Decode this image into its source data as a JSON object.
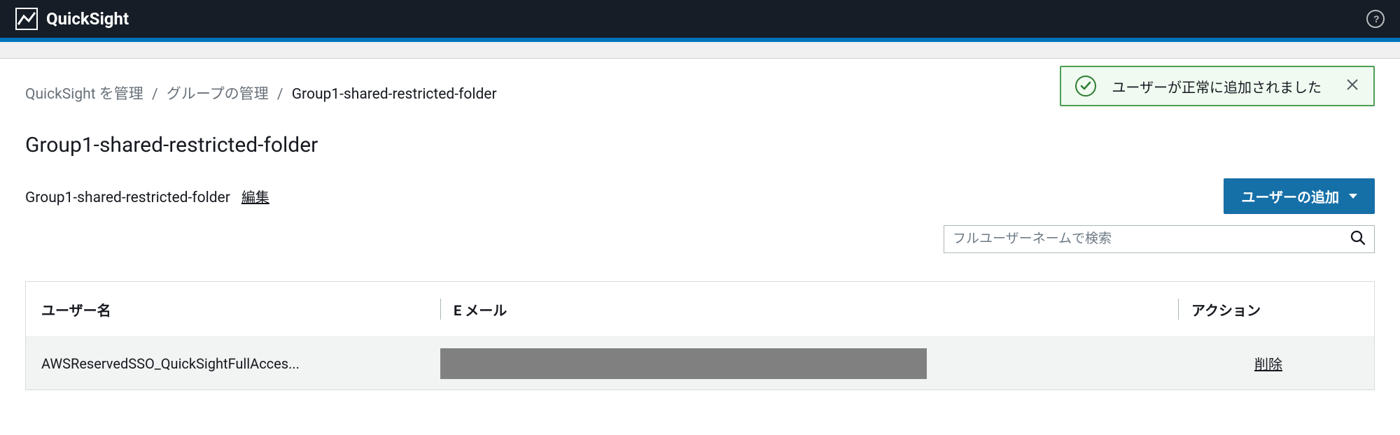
{
  "header": {
    "brand": "QuickSight"
  },
  "toast": {
    "message": "ユーザーが正常に追加されました"
  },
  "breadcrumb": {
    "items": [
      "QuickSight を管理",
      "グループの管理",
      "Group1-shared-restricted-folder"
    ]
  },
  "page": {
    "title": "Group1-shared-restricted-folder",
    "description": "Group1-shared-restricted-folder",
    "edit_label": "編集"
  },
  "buttons": {
    "add_user": "ユーザーの追加"
  },
  "search": {
    "placeholder": "フルユーザーネームで検索"
  },
  "table": {
    "columns": {
      "user": "ユーザー名",
      "email": "E メール",
      "action": "アクション"
    },
    "rows": [
      {
        "user": "AWSReservedSSO_QuickSightFullAcces...",
        "email": "",
        "action_label": "削除"
      }
    ]
  }
}
